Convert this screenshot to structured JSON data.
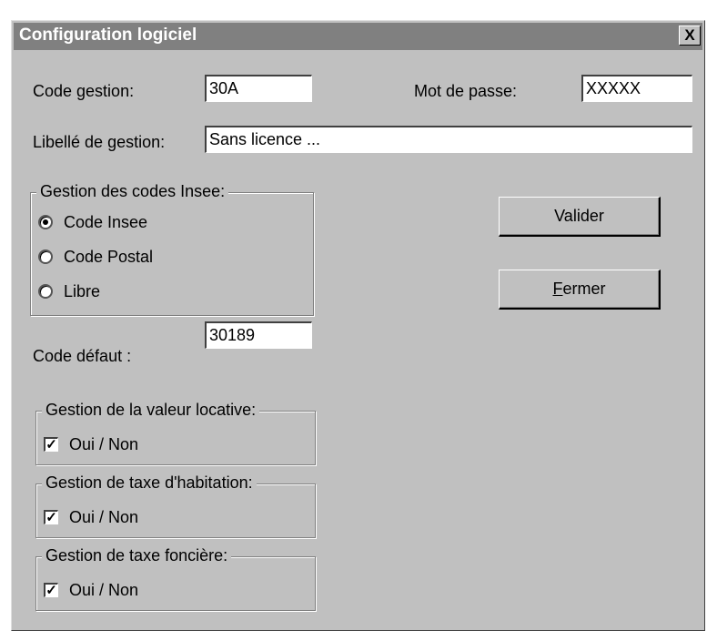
{
  "dialog": {
    "title": "Configuration logiciel",
    "close_label": "X"
  },
  "fields": {
    "code_gestion_label": "Code gestion:",
    "code_gestion_value": "30A",
    "mot_de_passe_label": "Mot de passe:",
    "mot_de_passe_value": "XXXXX",
    "libelle_label": "Libellé de gestion:",
    "libelle_value": "Sans licence ...",
    "code_defaut_label": "Code défaut :",
    "code_defaut_value": "30189"
  },
  "insee_group": {
    "legend": "Gestion des codes Insee:",
    "options": [
      {
        "label": "Code Insee",
        "selected": true
      },
      {
        "label": "Code Postal",
        "selected": false
      },
      {
        "label": "Libre",
        "selected": false
      }
    ]
  },
  "valeur_locative": {
    "legend": "Gestion de la valeur locative:",
    "check_label": "Oui / Non",
    "checked": true
  },
  "taxe_habitation": {
    "legend": "Gestion de taxe d'habitation:",
    "check_label": "Oui / Non",
    "checked": true
  },
  "taxe_fonciere": {
    "legend": "Gestion de taxe foncière:",
    "check_label": "Oui / Non",
    "checked": true
  },
  "buttons": {
    "valider": "Valider",
    "fermer_first": "F",
    "fermer_rest": "ermer"
  }
}
